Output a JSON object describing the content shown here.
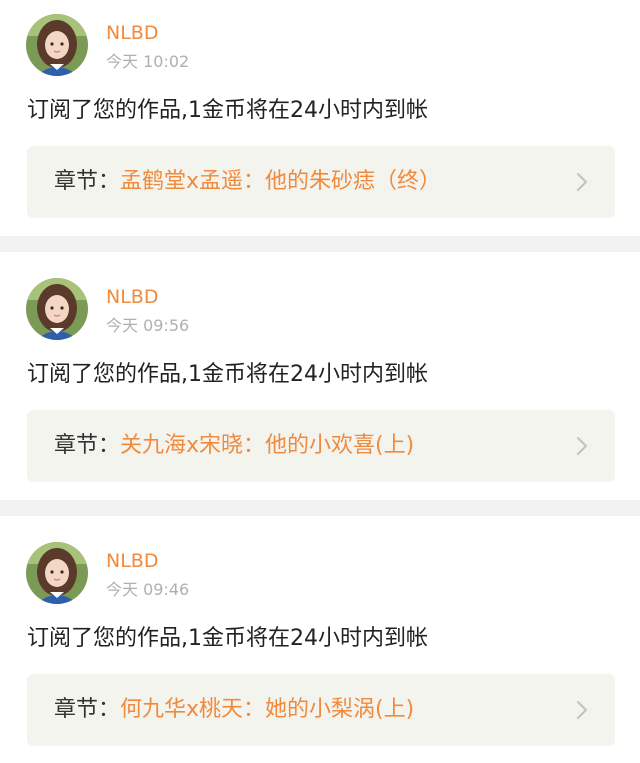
{
  "notifications": [
    {
      "username": "NLBD",
      "timestamp": "今天 10:02",
      "message": "订阅了您的作品,1金币将在24小时内到帐",
      "chapter_prefix": "章节：",
      "chapter_title": "孟鹤堂x孟遥：他的朱砂痣（终）"
    },
    {
      "username": "NLBD",
      "timestamp": "今天 09:56",
      "message": "订阅了您的作品,1金币将在24小时内到帐",
      "chapter_prefix": "章节：",
      "chapter_title": "关九海x宋晓：他的小欢喜(上)"
    },
    {
      "username": "NLBD",
      "timestamp": "今天 09:46",
      "message": "订阅了您的作品,1金币将在24小时内到帐",
      "chapter_prefix": "章节：",
      "chapter_title": "何九华x桃天：她的小梨涡(上)"
    }
  ],
  "icons": {
    "avatar": "user-avatar-photo",
    "chevron": "chevron-right-icon"
  },
  "colors": {
    "accent": "#f08a3c",
    "timestamp": "#b0b0b0",
    "text": "#222222",
    "chapter_background": "#f4f4ef",
    "separator": "#f2f2f2",
    "chevron": "#c4c4c4"
  }
}
